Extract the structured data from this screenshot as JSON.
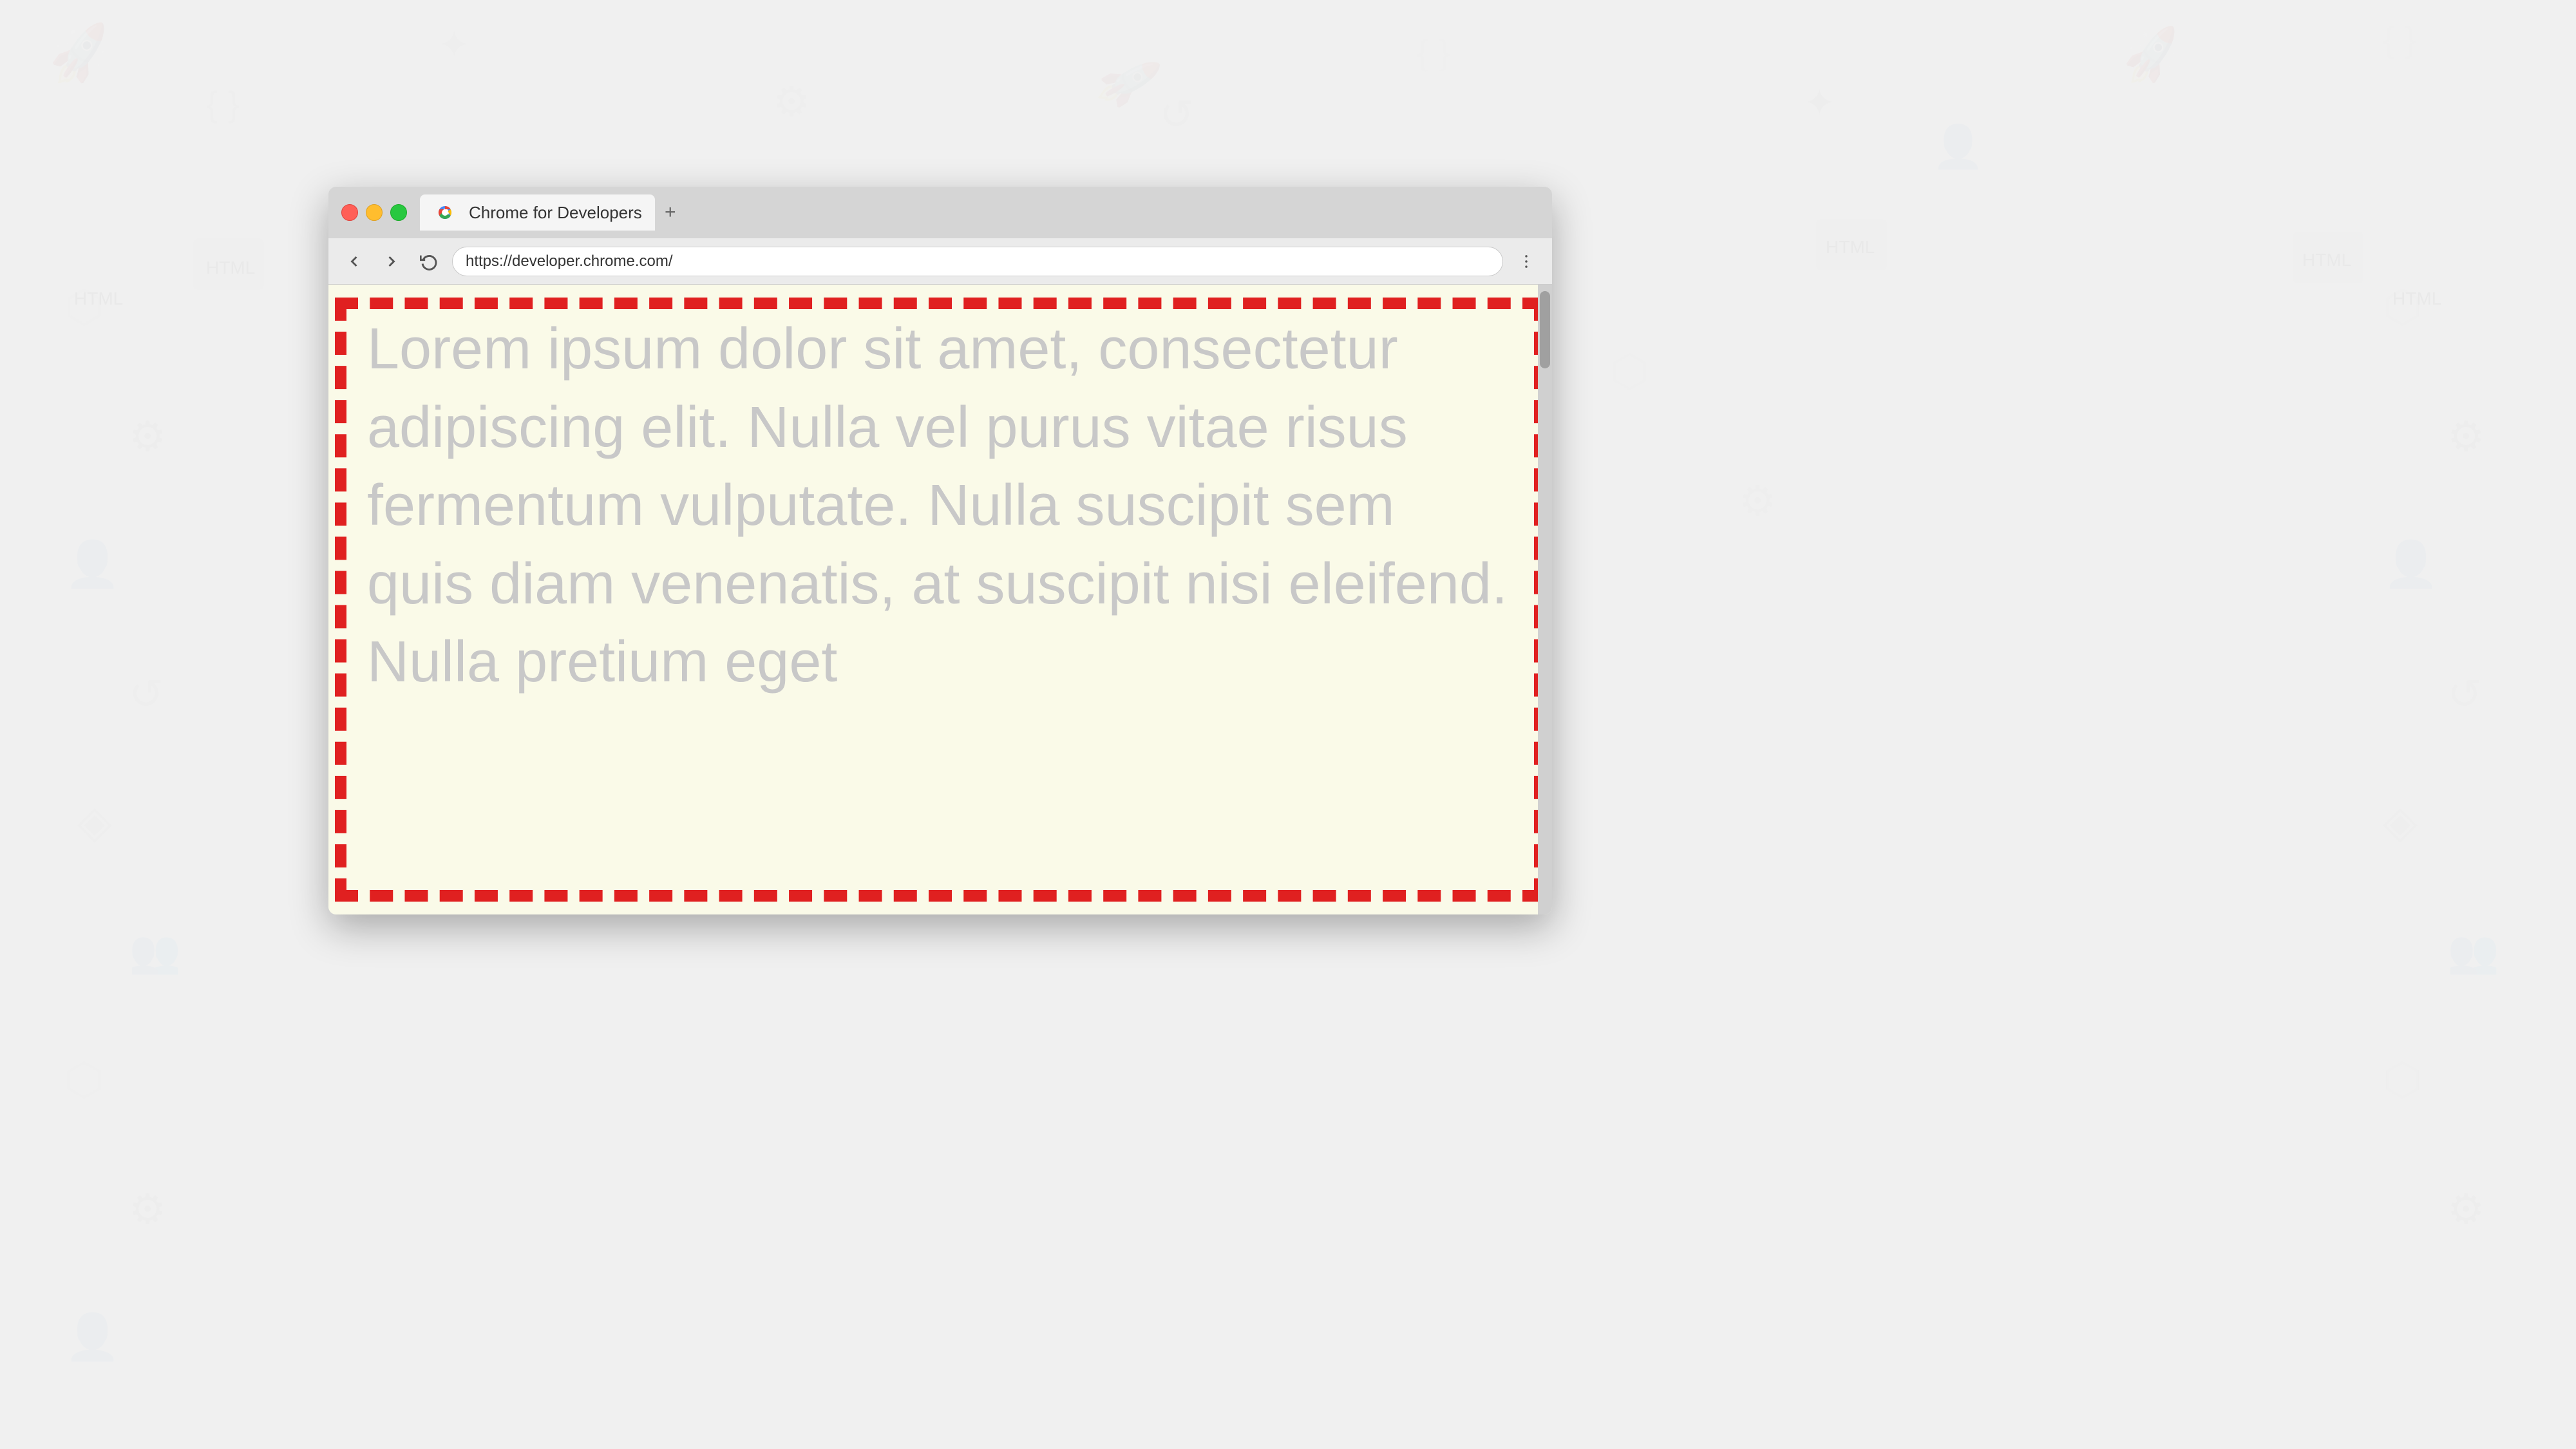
{
  "background": {
    "color": "#f0f0f0"
  },
  "browser": {
    "tab": {
      "title": "Chrome for Developers",
      "add_button": "+"
    },
    "address_bar": {
      "url": "https://developer.chrome.com/"
    },
    "nav": {
      "back_label": "back",
      "forward_label": "forward",
      "reload_label": "reload",
      "menu_label": "menu"
    }
  },
  "page_content": {
    "lorem_text": "Lorem ipsum dolor sit amet, consectetur adipiscing elit. Nulla vel purus vitae risus fermentum vulputate. Nulla suscipit sem quis diam venenatis, at suscipit nisi eleifend. Nulla pretium eget"
  }
}
